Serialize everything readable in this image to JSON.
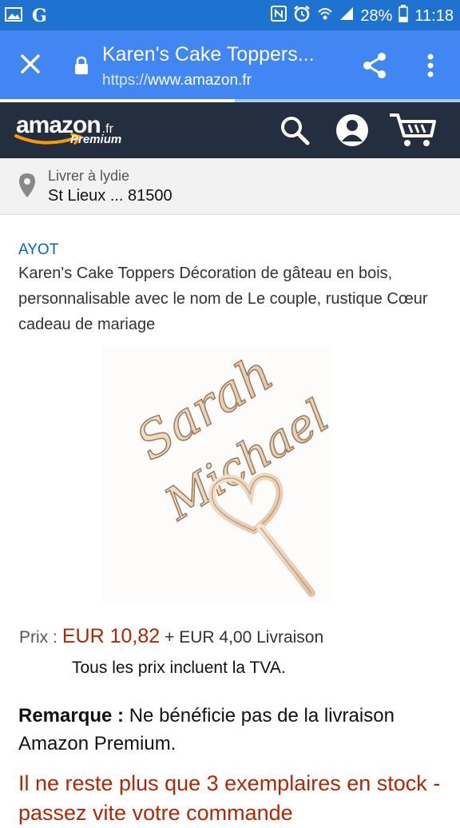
{
  "status_bar": {
    "battery": "28%",
    "time": "11:18",
    "icons": [
      "gallery-icon",
      "g-app-icon",
      "nfc-icon",
      "alarm-icon",
      "wifi-icon",
      "signal-icon",
      "battery-icon"
    ]
  },
  "browser": {
    "page_title": "Karen's Cake Toppers...",
    "url_scheme": "https://",
    "url_host": "www.amazon.fr",
    "load_progress": 0.51
  },
  "amazon_header": {
    "logo_word": "amazon",
    "logo_tld": ".fr",
    "logo_premium": "Premium"
  },
  "delivery": {
    "line1": "Livrer à lydie",
    "line2": "St Lieux ... 81500"
  },
  "product": {
    "brand": "AYOT",
    "title": "Karen's Cake Toppers Décoration de gâteau en bois, personnalisable avec le nom de Le couple, rustique Cœur cadeau de mariage",
    "image_text": [
      "Sarah",
      "Michael"
    ],
    "price_label": "Prix :",
    "price": "EUR 10,82",
    "shipping": "+ EUR 4,00 Livraison",
    "vat_note": "Tous les prix incluent la TVA.",
    "remark_label": "Remarque :",
    "remark_text": "Ne bénéficie pas de la livraison Amazon Premium.",
    "stock_text": "Il ne reste plus que 3 exemplaires en stock - passez vite votre commande"
  },
  "colors": {
    "status_bar": "#1f73d0",
    "browser_toolbar": "#4286f4",
    "amazon_header": "#232f3e",
    "price": "#b12704",
    "link": "#0066c0"
  }
}
